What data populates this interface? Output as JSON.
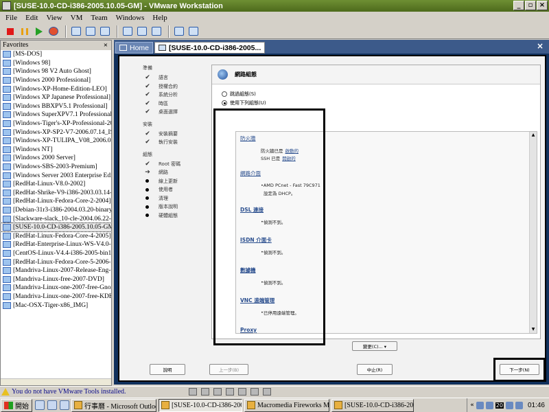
{
  "window": {
    "title": "[SUSE-10.0-CD-i386-2005.10.05-GM] - VMware Workstation",
    "btn_min": "_",
    "btn_restore": "▫",
    "btn_close": "×"
  },
  "menu": [
    "File",
    "Edit",
    "View",
    "VM",
    "Team",
    "Windows",
    "Help"
  ],
  "favorites": {
    "header": "Favorites",
    "close": "×",
    "items": [
      "[MS-DOS]",
      "[Windows 98]",
      "[Windows 98 V2 Auto Ghost]",
      "[Windows 2000 Professional]",
      "[Windows-XP-Home-Edition-LEO]",
      "[Windows XP Japanese Professional]",
      "[Windows BBXPV5.1 Professional]",
      "[Windows SuperXPV7.1 Professional]",
      "[Windows-Tiger's-XP-Professional-20",
      "[Windows-XP-SP2-V7-2006.07.14_IS",
      "[Windows-XP-TULIPA_V08_2006.08",
      "[Windows NT]",
      "[Windows 2000 Server]",
      "[Windows-SBS-2003-Premium]",
      "[Windows Server 2003 Enterprise Edit",
      "[RedHat-Linux-V8.0-2002]",
      "[RedHat-Shrike-V9-i386-2003.03.14-c",
      "[RedHat-Linux-Fedora-Core-2-2004]",
      "[Debian-31r3-i386-2004.03.20-binary",
      "[Slackware-slack_10-cle-2004.06.22-i",
      "[SUSE-10.0-CD-i386-2005.10.05-GM",
      "[RedHat-Linux-Fedora-Core-4-2005]",
      "[RedHat-Enterprise-Linux-WS-V4.0-2",
      "[CentOS-Linux-V4.4-i386-2005-bin1-",
      "[RedHat-Linux-Fedora-Core-5-2006-i",
      "[Mandriva-Linux-2007-Release-Eng-C",
      "[Mandriva-Linux-free-2007-DVD]",
      "[Mandriva-Linux-one-2007-free-Gnor",
      "[Mandriva-Linux-one-2007-free-KDE]",
      "[Mac-OSX-Tiger-x86_IMG]"
    ],
    "selected_index": 20
  },
  "tabs": {
    "home": "Home",
    "active": "[SUSE-10.0-CD-i386-2005...",
    "close": "×"
  },
  "installer": {
    "groups": [
      {
        "head": "準備",
        "steps": [
          {
            "mark": "check",
            "label": "語言"
          },
          {
            "mark": "check",
            "label": "授權合約"
          },
          {
            "mark": "check",
            "label": "系統分析"
          },
          {
            "mark": "check",
            "label": "時區"
          },
          {
            "mark": "check",
            "label": "桌面選擇"
          }
        ]
      },
      {
        "head": "安裝",
        "steps": [
          {
            "mark": "check",
            "label": "安裝摘要"
          },
          {
            "mark": "check",
            "label": "執行安裝"
          }
        ]
      },
      {
        "head": "組態",
        "steps": [
          {
            "mark": "check",
            "label": "Root 密碼"
          },
          {
            "mark": "arrow",
            "label": "網路"
          },
          {
            "mark": "dot",
            "label": "線上更新"
          },
          {
            "mark": "dot",
            "label": "使用者"
          },
          {
            "mark": "dot",
            "label": "清理"
          },
          {
            "mark": "dot",
            "label": "版本說明"
          },
          {
            "mark": "dot",
            "label": "硬體組態"
          }
        ]
      }
    ],
    "panel_title": "網路組態",
    "radio_skip": "跳過組態(S)",
    "radio_use": "使用下列組態(U)",
    "summary": {
      "firewall_head": "防火牆",
      "firewall_line1": "防火牆已是",
      "firewall_link1": "啟動的",
      "ssh_line": "SSH 已是",
      "ssh_link": "開啟的",
      "netif_head": "網路介面",
      "netif_line1": "AMD PCnet - Fast 79C971",
      "netif_line2": "設定為 DHCP。",
      "dsl_head": "DSL 連接",
      "dsl_line": "偵測不到。",
      "isdn_head": "ISDN 介面卡",
      "isdn_line": "偵測不到。",
      "modem_head": "數據機",
      "modem_line": "偵測不到。",
      "vnc_head": "VNC 遠端管理",
      "vnc_line": "已停用遠端管理。",
      "proxy_head": "Proxy"
    },
    "change_btn": "變更(C)... ▾",
    "help_btn": "說明",
    "back_btn": "上一步(B)",
    "abort_btn": "中止(R)",
    "next_btn": "下一步(N)"
  },
  "status": {
    "warning": "You do not have VMware Tools installed."
  },
  "taskbar": {
    "start": "開始",
    "tasks": [
      "行事曆 - Microsoft Outlook",
      "[SUSE-10.0-CD-i386-200...",
      "Macromedia Fireworks M...",
      "[SUSE-10.0-CD-i386-200..."
    ],
    "pressed_index": 1,
    "tray_badge": "20",
    "clock": "01:46"
  }
}
